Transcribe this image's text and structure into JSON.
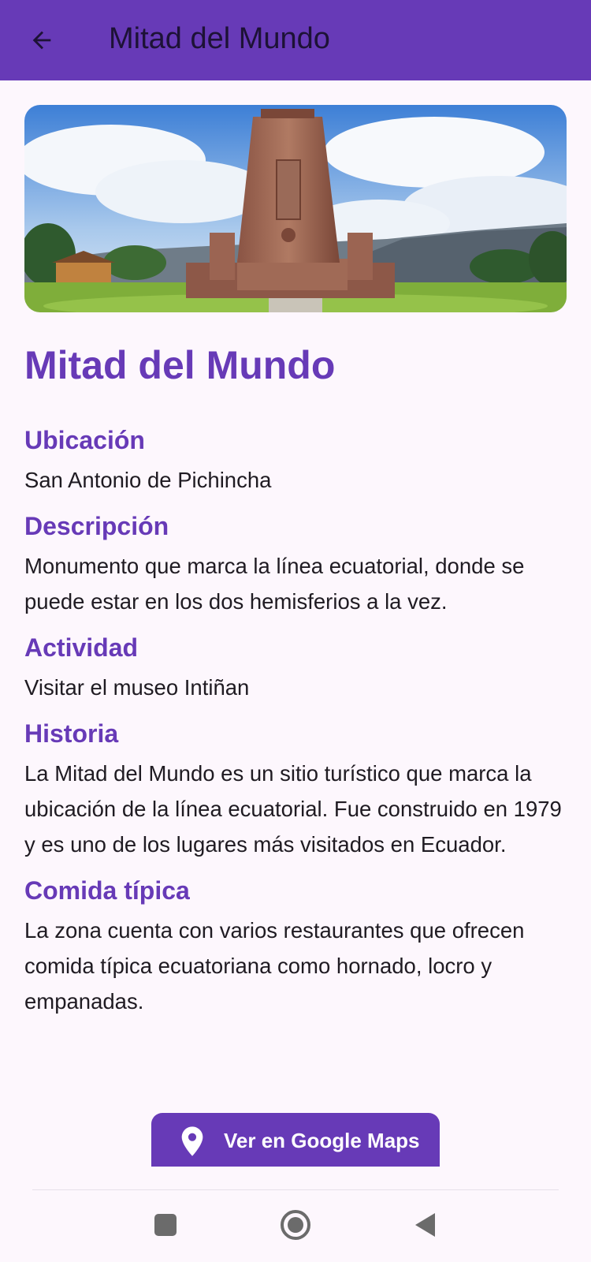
{
  "appbar": {
    "title": "Mitad del Mundo",
    "back_icon": "arrow-left-icon"
  },
  "hero": {
    "alt": "Mitad del Mundo monument"
  },
  "place": {
    "title": "Mitad del Mundo",
    "sections": [
      {
        "label": "Ubicación",
        "text": "San Antonio de Pichincha"
      },
      {
        "label": "Descripción",
        "text": "Monumento que marca la línea ecuatorial, donde se puede estar en los dos hemisferios a la vez."
      },
      {
        "label": "Actividad",
        "text": "Visitar el museo Intiñan"
      },
      {
        "label": "Historia",
        "text": "La Mitad del Mundo es un sitio turístico que marca la ubicación de la línea ecuatorial. Fue construido en 1979 y es uno de los lugares más visitados en Ecuador."
      },
      {
        "label": "Comida típica",
        "text": "La zona cuenta con varios restaurantes que ofrecen comida típica ecuatoriana como hornado, locro y empanadas."
      }
    ]
  },
  "maps_button": {
    "label": "Ver en Google Maps",
    "icon": "map-pin-icon"
  },
  "nav": {
    "recents_icon": "square-icon",
    "home_icon": "circle-icon",
    "back_icon": "triangle-back-icon"
  },
  "colors": {
    "primary": "#673ab7",
    "background": "#fdf7fd",
    "text": "#1f1b22"
  }
}
